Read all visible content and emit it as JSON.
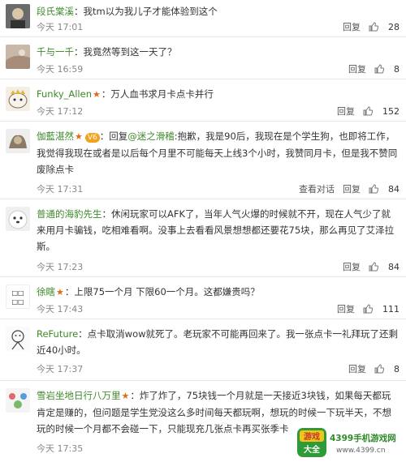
{
  "comments": [
    {
      "name": "段氏棠溪",
      "star": false,
      "text": "我tm以为我儿子才能体验到这个",
      "time": "今天 17:01",
      "reply": "回复",
      "likes": "28"
    },
    {
      "name": "千与一千",
      "star": false,
      "text": "我竟然等到这一天了？",
      "time": "今天 16:59",
      "reply": "回复",
      "likes": "8"
    },
    {
      "name": "Funky_Allen",
      "star": true,
      "text": "万人血书求月卡点卡并行",
      "time": "今天 17:12",
      "reply": "回复",
      "likes": "152"
    },
    {
      "name": "伽藍湛然",
      "star": true,
      "vip": "V6",
      "reply_prefix": "回复",
      "mention": "@迷之滑稽",
      "text": "抱歉，我是90后，我现在是个学生狗，也即将工作，我觉得我现在或者是以后每个月里不可能每天上线3个小时，我赞同月卡，但是我不赞同废除点卡",
      "time": "今天 17:31",
      "view_conv": "查看对话",
      "reply": "回复",
      "likes": "84"
    },
    {
      "name": "普通的海豹先生",
      "star": false,
      "text": "休闲玩家可以AFK了，当年人气火爆的时候就不开，现在人气少了就来用月卡骗钱，吃相难看啊。没事上去看看风景想想都还要花75块，那么再见了艾泽拉斯。",
      "time": "今天 17:23",
      "reply": "回复",
      "likes": "84"
    },
    {
      "name": "徐瞎",
      "star": true,
      "text": "上限75一个月 下限60一个月。这都嫌贵吗？",
      "time": "今天 17:43",
      "reply": "回复",
      "likes": "111"
    },
    {
      "name": "ReFuture",
      "star": false,
      "text": "点卡取消wow就死了。老玩家不可能再回来了。我一张点卡一礼拜玩了还剩近40小时。",
      "time": "今天 17:37",
      "reply": "回复",
      "likes": "8"
    },
    {
      "name": "雪岩坐地日行八万里",
      "star": true,
      "text": "炸了炸了，75块钱一个月就是一天接近3块钱，如果每天都玩肯定是赚的，但问题是学生党没这么多时间每天都玩啊，想玩的时候一下玩半天，不想玩的时候一个月都不会碰一下，只能现充几张点卡再买张季卡",
      "time": "今天 17:35",
      "reply": "回复",
      "likes": ""
    }
  ],
  "logo": {
    "badge_top": "游戏",
    "badge_bottom": "大全",
    "site": "4399手机游戏网",
    "url": "www.4399.cn"
  },
  "colors": {
    "name": "#3d8a2a",
    "star": "#e06a1a",
    "meta": "#888888"
  }
}
